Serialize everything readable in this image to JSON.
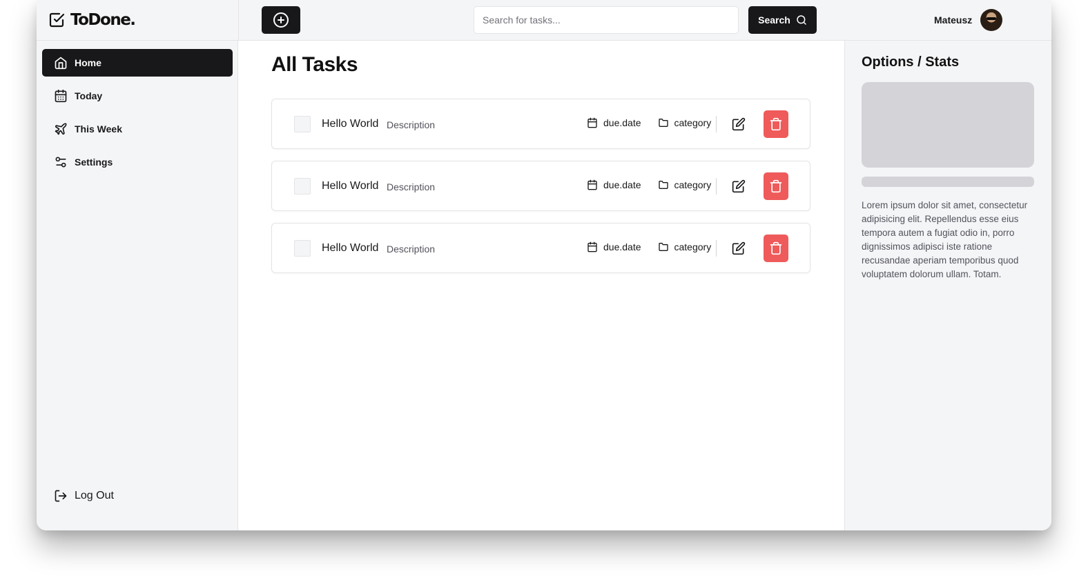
{
  "brand": {
    "name": "ToDone."
  },
  "header": {
    "search_placeholder": "Search for tasks...",
    "search_label": "Search",
    "user_name": "Mateusz"
  },
  "sidebar": {
    "items": [
      {
        "label": "Home",
        "icon": "home-icon",
        "active": true
      },
      {
        "label": "Today",
        "icon": "calendar-icon",
        "active": false
      },
      {
        "label": "This Week",
        "icon": "plane-icon",
        "active": false
      },
      {
        "label": "Settings",
        "icon": "settings-sliders-icon",
        "active": false
      }
    ],
    "logout_label": "Log Out"
  },
  "main": {
    "title": "All Tasks",
    "tasks": [
      {
        "title": "Hello World",
        "description": "Description",
        "due": "due.date",
        "category": "category"
      },
      {
        "title": "Hello World",
        "description": "Description",
        "due": "due.date",
        "category": "category"
      },
      {
        "title": "Hello World",
        "description": "Description",
        "due": "due.date",
        "category": "category"
      }
    ]
  },
  "panel": {
    "title": "Options / Stats",
    "text": "Lorem ipsum dolor sit amet, consectetur adipisicing elit. Repellendus esse eius tempora autem a fugiat odio in, porro dignissimos adipisci iste ratione recusandae aperiam temporibus quod voluptatem dolorum ullam. Totam."
  },
  "colors": {
    "accent_dark": "#18181b",
    "danger": "#ef5a5a",
    "surface": "#f4f5f7",
    "placeholder": "#d4d4d8"
  }
}
